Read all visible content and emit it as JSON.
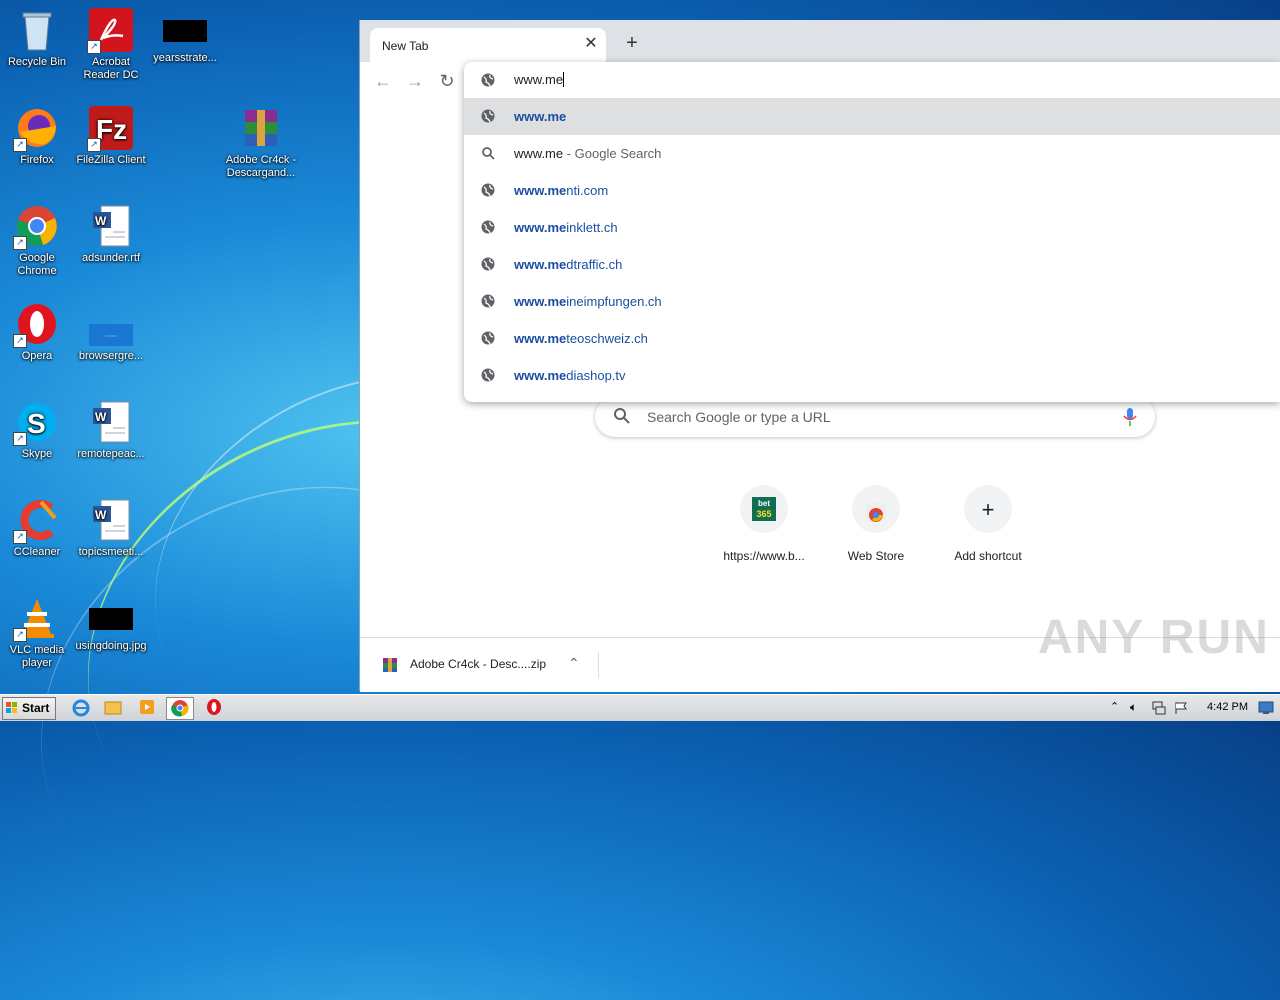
{
  "desktop": {
    "icons": [
      {
        "label": "Recycle Bin"
      },
      {
        "label": "Acrobat Reader DC"
      },
      {
        "label": "yearsstrate..."
      },
      {
        "label": "Firefox"
      },
      {
        "label": "FileZilla Client"
      },
      {
        "label": "Adobe Cr4ck - Descargand..."
      },
      {
        "label": "Google Chrome"
      },
      {
        "label": "adsunder.rtf"
      },
      {
        "label": "Opera"
      },
      {
        "label": "browsergre..."
      },
      {
        "label": "Skype"
      },
      {
        "label": "remotepeac..."
      },
      {
        "label": "CCleaner"
      },
      {
        "label": "topicsmeeti..."
      },
      {
        "label": "VLC media player"
      },
      {
        "label": "usingdoing.jpg"
      }
    ]
  },
  "browser": {
    "tab_title": "New Tab",
    "omnibox": {
      "typed": "www.me",
      "suggestions": [
        {
          "bold": "www.me",
          "rest": "",
          "kind": "url",
          "selected": true
        },
        {
          "bold": "www.me",
          "rest": " - Google Search",
          "kind": "search",
          "selected": false
        },
        {
          "bold": "www.me",
          "rest": "nti.com",
          "kind": "url",
          "selected": false
        },
        {
          "bold": "www.me",
          "rest": "inklett.ch",
          "kind": "url",
          "selected": false
        },
        {
          "bold": "www.me",
          "rest": "dtraffic.ch",
          "kind": "url",
          "selected": false
        },
        {
          "bold": "www.me",
          "rest": "ineimpfungen.ch",
          "kind": "url",
          "selected": false
        },
        {
          "bold": "www.me",
          "rest": "teoschweiz.ch",
          "kind": "url",
          "selected": false
        },
        {
          "bold": "www.me",
          "rest": "diashop.tv",
          "kind": "url",
          "selected": false
        }
      ]
    },
    "ntp": {
      "search_placeholder": "Search Google or type a URL",
      "shortcuts": [
        {
          "label": "https://www.b...",
          "icon_text": "bet 365"
        },
        {
          "label": "Web Store"
        },
        {
          "label": "Add shortcut"
        }
      ]
    },
    "download": {
      "filename": "Adobe Cr4ck - Desc....zip"
    }
  },
  "watermark": "ANY RUN",
  "taskbar": {
    "start_label": "Start",
    "clock": "4:42 PM"
  }
}
